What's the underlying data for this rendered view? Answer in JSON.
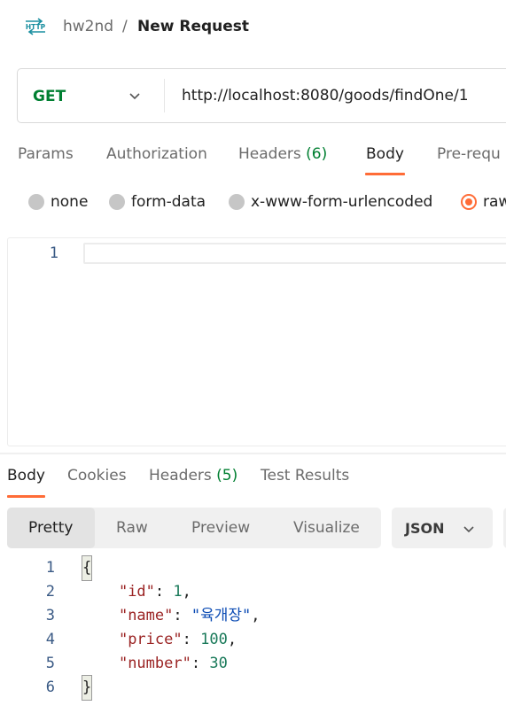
{
  "breadcrumb": {
    "icon": "http-icon",
    "collection": "hw2nd",
    "separator": "/",
    "request": "New Request"
  },
  "request": {
    "method": "GET",
    "url": "http://localhost:8080/goods/findOne/1"
  },
  "request_tabs": [
    {
      "label": "Params",
      "count": ""
    },
    {
      "label": "Authorization",
      "count": ""
    },
    {
      "label": "Headers",
      "count": "(6)"
    },
    {
      "label": "Body",
      "count": "",
      "active": true
    },
    {
      "label": "Pre-requ",
      "count": ""
    }
  ],
  "body_types": [
    {
      "label": "none",
      "selected": false
    },
    {
      "label": "form-data",
      "selected": false
    },
    {
      "label": "x-www-form-urlencoded",
      "selected": false
    },
    {
      "label": "raw",
      "selected": true
    }
  ],
  "request_editor": {
    "line_numbers": [
      "1"
    ]
  },
  "response_tabs": [
    {
      "label": "Body",
      "count": "",
      "active": true
    },
    {
      "label": "Cookies",
      "count": ""
    },
    {
      "label": "Headers",
      "count": "(5)"
    },
    {
      "label": "Test Results",
      "count": ""
    }
  ],
  "view_modes": [
    {
      "label": "Pretty",
      "active": true
    },
    {
      "label": "Raw"
    },
    {
      "label": "Preview"
    },
    {
      "label": "Visualize"
    }
  ],
  "format": {
    "label": "JSON"
  },
  "response_body": {
    "line_numbers": [
      "1",
      "2",
      "3",
      "4",
      "5",
      "6"
    ],
    "open_brace": "{",
    "close_brace": "}",
    "fields": [
      {
        "key": "\"id\"",
        "value": "1",
        "value_type": "num",
        "comma": ","
      },
      {
        "key": "\"name\"",
        "value": "\"육개장\"",
        "value_type": "str",
        "comma": ","
      },
      {
        "key": "\"price\"",
        "value": "100",
        "value_type": "num",
        "comma": ","
      },
      {
        "key": "\"number\"",
        "value": "30",
        "value_type": "num",
        "comma": ""
      }
    ]
  },
  "colors": {
    "accent": "#ff6c37",
    "method_get": "#007f31",
    "json_key": "#9b2424",
    "json_string": "#0b4bb4",
    "json_number": "#1a7a5a"
  }
}
